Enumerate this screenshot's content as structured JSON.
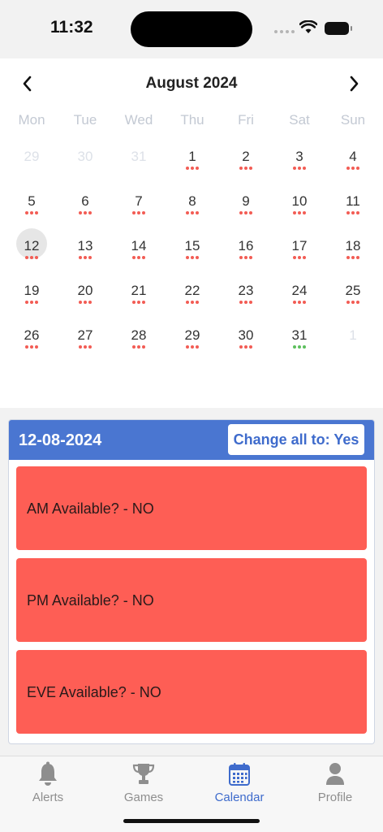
{
  "status_bar": {
    "time": "11:32",
    "icons": [
      "signal-icon",
      "wifi-icon",
      "battery-icon"
    ]
  },
  "calendar": {
    "month_title": "August 2024",
    "nav": {
      "prev_icon": "chevron-left-icon",
      "next_icon": "chevron-right-icon"
    },
    "weekdays": [
      "Mon",
      "Tue",
      "Wed",
      "Thu",
      "Fri",
      "Sat",
      "Sun"
    ],
    "weeks": [
      [
        {
          "label": "29",
          "muted": true,
          "dots": "none"
        },
        {
          "label": "30",
          "muted": true,
          "dots": "none"
        },
        {
          "label": "31",
          "muted": true,
          "dots": "none"
        },
        {
          "label": "1",
          "dots": "red"
        },
        {
          "label": "2",
          "dots": "red"
        },
        {
          "label": "3",
          "dots": "red"
        },
        {
          "label": "4",
          "dots": "red"
        }
      ],
      [
        {
          "label": "5",
          "dots": "red"
        },
        {
          "label": "6",
          "dots": "red"
        },
        {
          "label": "7",
          "dots": "red"
        },
        {
          "label": "8",
          "dots": "red"
        },
        {
          "label": "9",
          "dots": "red"
        },
        {
          "label": "10",
          "dots": "red"
        },
        {
          "label": "11",
          "dots": "red"
        }
      ],
      [
        {
          "label": "12",
          "dots": "red",
          "selected": true
        },
        {
          "label": "13",
          "dots": "red"
        },
        {
          "label": "14",
          "dots": "red"
        },
        {
          "label": "15",
          "dots": "red"
        },
        {
          "label": "16",
          "dots": "red"
        },
        {
          "label": "17",
          "dots": "red"
        },
        {
          "label": "18",
          "dots": "red"
        }
      ],
      [
        {
          "label": "19",
          "dots": "red"
        },
        {
          "label": "20",
          "dots": "red"
        },
        {
          "label": "21",
          "dots": "red"
        },
        {
          "label": "22",
          "dots": "red"
        },
        {
          "label": "23",
          "dots": "red"
        },
        {
          "label": "24",
          "dots": "red"
        },
        {
          "label": "25",
          "dots": "red"
        }
      ],
      [
        {
          "label": "26",
          "dots": "red"
        },
        {
          "label": "27",
          "dots": "red"
        },
        {
          "label": "28",
          "dots": "red"
        },
        {
          "label": "29",
          "dots": "red"
        },
        {
          "label": "30",
          "dots": "red"
        },
        {
          "label": "31",
          "dots": "green"
        },
        {
          "label": "1",
          "muted": true,
          "dots": "none"
        }
      ]
    ],
    "colors": {
      "dot_red": "#f25c54",
      "dot_green": "#5cbf5c"
    }
  },
  "day_panel": {
    "date": "12-08-2024",
    "change_all_label": "Change all to: Yes",
    "slots": [
      {
        "label": "AM Available? - NO"
      },
      {
        "label": "PM Available? - NO"
      },
      {
        "label": "EVE Available? - NO"
      }
    ],
    "colors": {
      "header": "#4a76d1",
      "slot_no": "#fe5e55"
    }
  },
  "tab_bar": {
    "tabs": [
      {
        "label": "Alerts",
        "icon": "bell-icon"
      },
      {
        "label": "Games",
        "icon": "trophy-icon"
      },
      {
        "label": "Calendar",
        "icon": "calendar-icon",
        "active": true
      },
      {
        "label": "Profile",
        "icon": "user-icon"
      }
    ],
    "colors": {
      "active": "#3e6bcc",
      "inactive": "#8e8e8e"
    }
  }
}
